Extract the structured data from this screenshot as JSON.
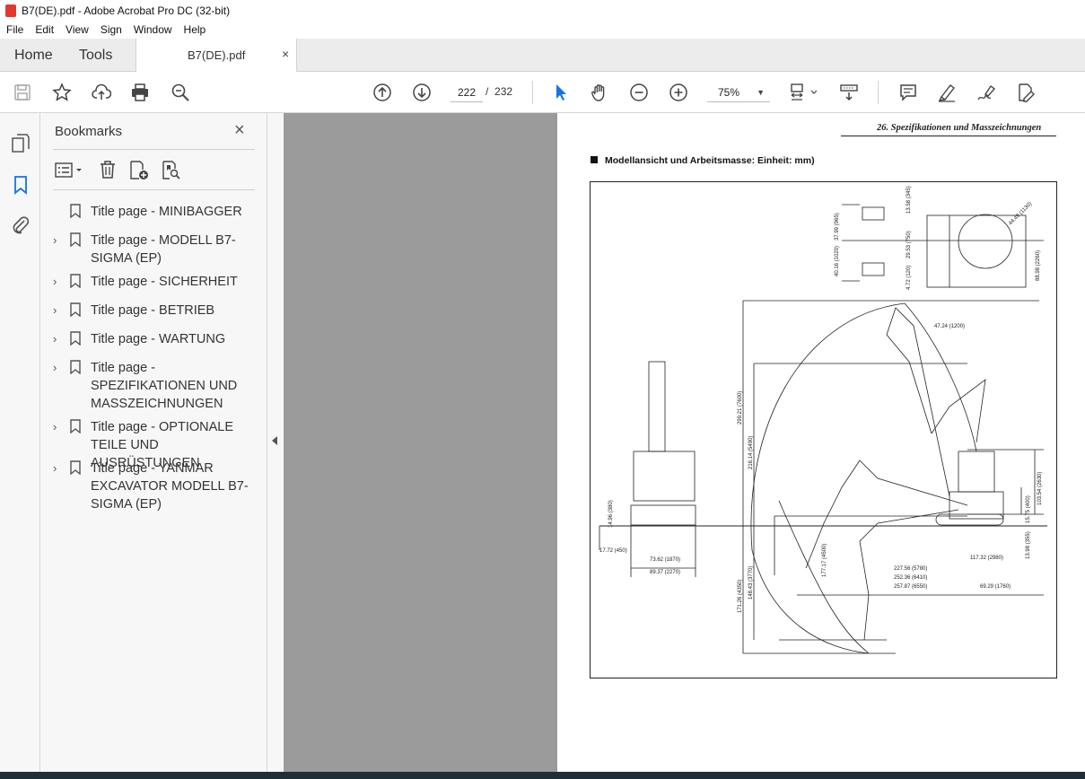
{
  "window": {
    "title": "B7(DE).pdf - Adobe Acrobat Pro DC (32-bit)"
  },
  "menu": [
    "File",
    "Edit",
    "View",
    "Sign",
    "Window",
    "Help"
  ],
  "tabs": {
    "home": "Home",
    "tools": "Tools",
    "document": "B7(DE).pdf",
    "close": "×"
  },
  "toolbar": {
    "current_page": "222",
    "page_separator": "/",
    "page_count": "232",
    "zoom": "75%"
  },
  "bookmarks": {
    "heading": "Bookmarks",
    "close": "×",
    "items": [
      {
        "label": "Title page - MINIBAGGER",
        "expandable": false
      },
      {
        "label": "Title page - MODELL B7-SIGMA (EP)",
        "expandable": true
      },
      {
        "label": "Title page - SICHERHEIT",
        "expandable": true
      },
      {
        "label": "Title page - BETRIEB",
        "expandable": true
      },
      {
        "label": "Title page - WARTUNG",
        "expandable": true
      },
      {
        "label": "Title page - SPEZIFIKATIONEN UND MASSZEICHNUNGEN",
        "expandable": true
      },
      {
        "label": "Title page - OPTIONALE TEILE UND AUSRÜSTUNGEN",
        "expandable": true
      },
      {
        "label": "Title page - YANMAR EXCAVATOR MODELL B7-SIGMA (EP)",
        "expandable": true
      }
    ]
  },
  "document": {
    "header": "26. Spezifikationen und Masszeichnungen",
    "section_title": "Modellansicht und Arbeitsmasse: Einheit: mm)",
    "dimensions": {
      "d1": "47.24 (1200)",
      "d2": "299.21 (7600)",
      "d3": "216.14 (5490)",
      "d4": "103.54 (2630)",
      "d5": "15.75 (400)",
      "d6": "13.98 (355)",
      "d7": "117.32 (2980)",
      "d8": "227.56 (5780)",
      "d9": "252.36 (6410)",
      "d10": "257.87 (6550)",
      "d11": "69.29 (1760)",
      "d12": "177.17 (4500)",
      "d13": "171.26 (4350)",
      "d14": "148.43 (3770)",
      "d15": "17.72 (450)",
      "d16": "73.62 (1870)",
      "d17": "89.37 (2270)",
      "d18": "14.96 (380)",
      "d19": "88.98 (2260)",
      "d20": "44.49 (1130)",
      "d21": "37.99 (965)",
      "d22": "40.16 (1020)",
      "d23": "29.53 (750)",
      "d24": "13.58 (345)",
      "d25": "4.72 (120)"
    }
  },
  "colors": {
    "accent": "#1473e6",
    "canvas": "#9b9b9b",
    "pdf_icon": "#e03a2f"
  }
}
